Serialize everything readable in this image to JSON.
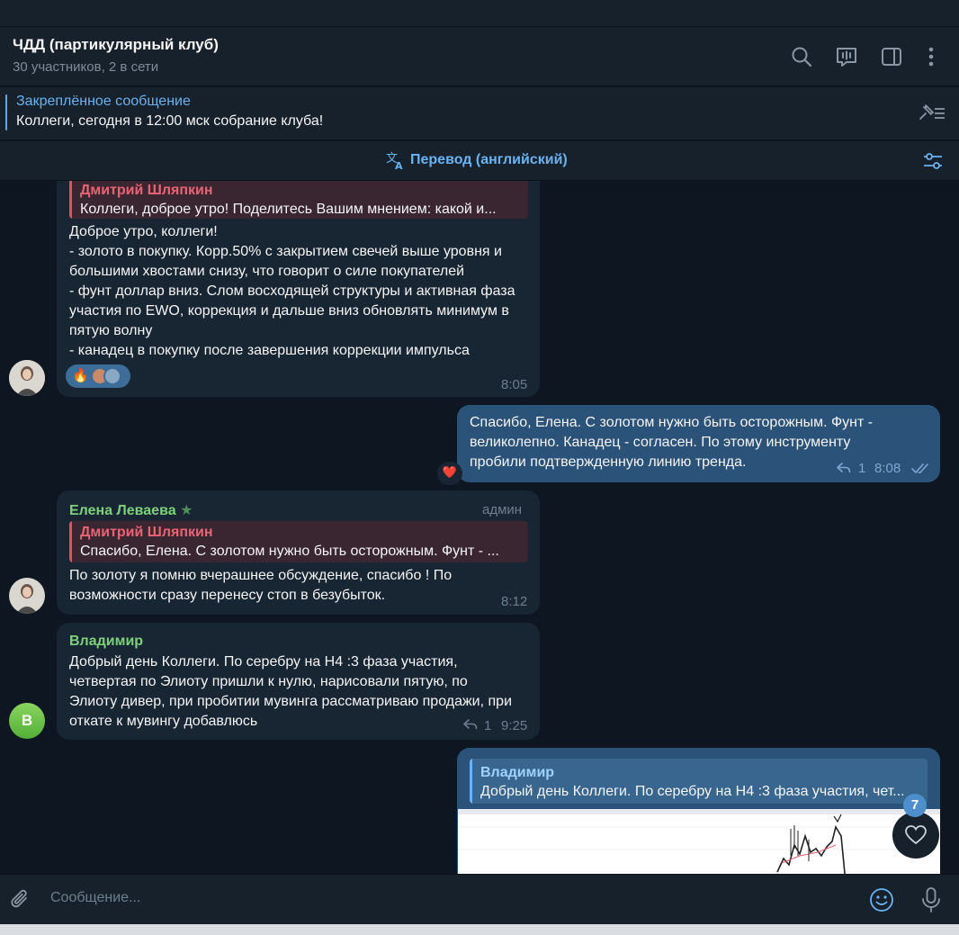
{
  "header": {
    "title": "ЧДД (партикулярный клуб)",
    "subtitle": "30 участников, 2 в сети",
    "icons": [
      "search-icon",
      "live-chat-icon",
      "sidebar-toggle-icon",
      "more-vertical-icon"
    ]
  },
  "pinned": {
    "title": "Закреплённое сообщение",
    "text": "Коллеги, сегодня в 12:00 мск собрание клуба!"
  },
  "translate_bar": {
    "label": "Перевод (английский)"
  },
  "messages": {
    "m1": {
      "reply_name": "Дмитрий Шляпкин",
      "reply_text": "Коллеги, доброе утро! Поделитесь Вашим мнением: какой и...",
      "text": "Доброе утро, коллеги!\n- золото в покупку. Корр.50% с закрытием свечей выше уровня и большими хвостами снизу, что говорит о силе покупателей\n- фунт доллар вниз. Слом восходящей структуры и активная фаза участия по EWO, коррекция и дальше вниз обновлять минимум в пятую волну\n- канадец в покупку после завершения коррекции импульса",
      "reactions": "🔥",
      "time": "8:05"
    },
    "m2": {
      "text": "Спасибо, Елена. С золотом нужно быть осторожным. Фунт - великолепно. Канадец - согласен. По этому инструменту пробили подтвержденную линию тренда.",
      "replies": "1",
      "time": "8:08",
      "reaction": "❤️"
    },
    "m3": {
      "sender": "Елена Леваева",
      "role": "админ",
      "reply_name": "Дмитрий Шляпкин",
      "reply_text": "Спасибо, Елена. С золотом нужно быть осторожным. Фунт - ...",
      "text": "По золоту я помню вчерашнее обсуждение, спасибо ! По возможности сразу перенесу стоп в безубыток.",
      "time": "8:12"
    },
    "m4": {
      "sender": "Владимир",
      "avatar_letter": "В",
      "text": "Добрый день Коллеги. По серебру на Н4 :3 фаза участия, четвертая по Элиоту пришли к нулю, нарисовали пятую, по Элиоту дивер, при пробитии мувинга рассматриваю продажи, при откате к мувингу добавлюсь",
      "replies": "1",
      "time": "9:25"
    },
    "m5": {
      "reply_name": "Владимир",
      "reply_text": "Добрый день Коллеги. По серебру на Н4 :3 фаза участия, чет..."
    }
  },
  "fab": {
    "badge": "7"
  },
  "composer": {
    "placeholder": "Сообщение..."
  },
  "colors": {
    "bg": "#0e1621",
    "panel": "#17212b",
    "incoming": "#182533",
    "outgoing": "#2b5278",
    "accent": "#6ab2f2",
    "sender_green": "#7cd17a"
  }
}
